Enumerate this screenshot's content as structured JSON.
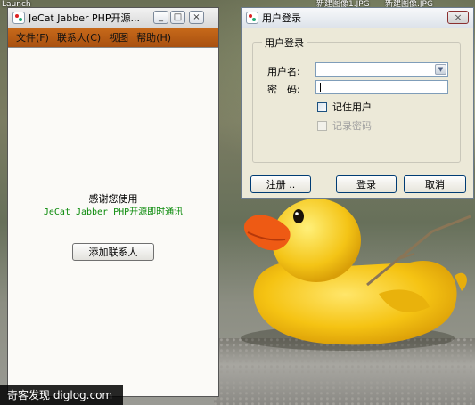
{
  "desktop": {
    "labels": [
      "Launch",
      "新建图像1.JPG",
      "新建图像.JPG"
    ],
    "watermark": "奇客发现 diglog.com"
  },
  "main_window": {
    "title": "JeCat Jabber PHP开源...",
    "controls": {
      "minimize": "_",
      "restore": "□",
      "close": "×"
    },
    "menu": [
      "文件(F)",
      "联系人(C)",
      "视图",
      "帮助(H)"
    ],
    "thanks_text": "感谢您使用",
    "product_text": "JeCat Jabber PHP开源即时通讯",
    "add_contact_label": "添加联系人",
    "colors": {
      "menubar": "#b85e14",
      "product_text": "#0a8a0a"
    }
  },
  "login_window": {
    "title": "用户登录",
    "close_symbol": "×",
    "group_title": "用户登录",
    "username_label": "用户名:",
    "username_value": "",
    "password_label": "密　码:",
    "password_value": "",
    "remember_user_label": "记住用户",
    "remember_password_label": "记录密码",
    "register_label": "注册 ..",
    "login_label": "登录",
    "cancel_label": "取消"
  }
}
